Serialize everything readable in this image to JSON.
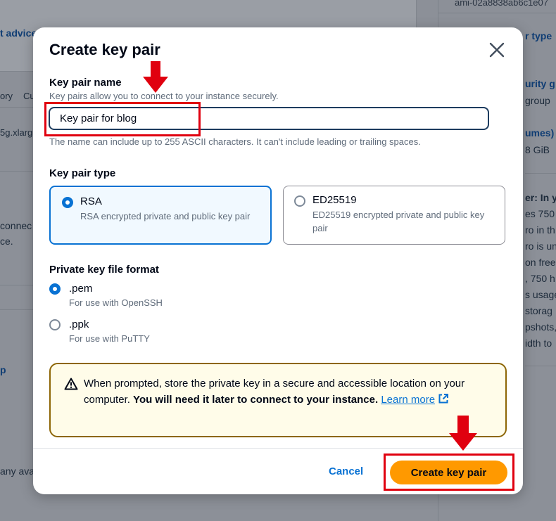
{
  "background": {
    "ami_id": "ami-02a8838ab6c1e07",
    "left_fragments": [
      "t advice",
      "ory",
      "Cu",
      "5g.xlarg",
      "connec",
      "ce.",
      "p",
      "any ava"
    ],
    "right_fragments": [
      "r type",
      "urity g",
      "group",
      "umes)",
      "8 GiB",
      "er: In y",
      "es 750",
      "ro in th",
      "ro is un",
      "on free",
      ", 750 h",
      "s usage",
      "storag",
      "pshots,",
      "idth to"
    ]
  },
  "modal": {
    "title": "Create key pair",
    "close_label": "Close",
    "key_pair_name": {
      "label": "Key pair name",
      "description": "Key pairs allow you to connect to your instance securely.",
      "value": "Key pair for blog",
      "constraint": "The name can include up to 255 ASCII characters. It can't include leading or trailing spaces."
    },
    "key_pair_type": {
      "label": "Key pair type",
      "options": [
        {
          "title": "RSA",
          "description": "RSA encrypted private and public key pair",
          "selected": true
        },
        {
          "title": "ED25519",
          "description": "ED25519 encrypted private and public key pair",
          "selected": false
        }
      ]
    },
    "file_format": {
      "label": "Private key file format",
      "options": [
        {
          "title": ".pem",
          "description": "For use with OpenSSH",
          "selected": true
        },
        {
          "title": ".ppk",
          "description": "For use with PuTTY",
          "selected": false
        }
      ]
    },
    "alert": {
      "text_plain": "When prompted, store the private key in a secure and accessible location on your computer.",
      "text_bold": "You will need it later to connect to your instance.",
      "link_text": "Learn more"
    },
    "footer": {
      "cancel_label": "Cancel",
      "create_label": "Create key pair"
    }
  },
  "colors": {
    "primary_button": "#ff9900",
    "link_blue": "#0972d3",
    "annotation_red": "#e0000f",
    "alert_border": "#8d6605"
  }
}
